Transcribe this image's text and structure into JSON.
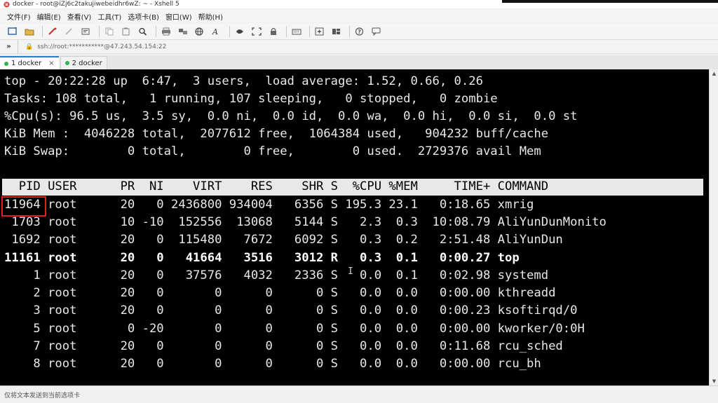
{
  "window": {
    "title": "docker - root@iZj6c2takujiwebeidhr6wZ: ~ - Xshell 5"
  },
  "menu": {
    "items": [
      "文件(F)",
      "编辑(E)",
      "查看(V)",
      "工具(T)",
      "选项卡(B)",
      "窗口(W)",
      "帮助(H)"
    ]
  },
  "toolbar": {
    "icons": [
      "new-session-icon",
      "open-folder-icon",
      "reconnect-icon",
      "disconnect-icon",
      "properties-icon",
      "copy-icon",
      "paste-icon",
      "find-icon",
      "print-icon",
      "transfer-icon",
      "globe-icon",
      "font-icon",
      "script-icon",
      "fullscreen-icon",
      "lock-icon",
      "keyboard-icon",
      "add-tab-icon",
      "layout-icon",
      "help-icon",
      "chat-icon"
    ]
  },
  "address": {
    "arrows": "»",
    "url": "ssh://root:***********@47.243.54.154:22"
  },
  "tabs": [
    {
      "label": "1 docker",
      "active": true
    },
    {
      "label": "2 docker",
      "active": false
    }
  ],
  "terminal": {
    "summary": [
      "top - 20:22:28 up  6:47,  3 users,  load average: 1.52, 0.66, 0.26",
      "Tasks: 108 total,   1 running, 107 sleeping,   0 stopped,   0 zombie",
      "%Cpu(s): 96.5 us,  3.5 sy,  0.0 ni,  0.0 id,  0.0 wa,  0.0 hi,  0.0 si,  0.0 st",
      "KiB Mem :  4046228 total,  2077612 free,  1064384 used,   904232 buff/cache",
      "KiB Swap:        0 total,        0 free,        0 used.  2729376 avail Mem"
    ],
    "header": "  PID USER      PR  NI    VIRT    RES    SHR S  %CPU %MEM     TIME+ COMMAND",
    "rows": [
      "11964 root      20   0 2436800 934004   6356 S 195.3 23.1   0:18.65 xmrig",
      " 1703 root      10 -10  152556  13068   5144 S   2.3  0.3  10:08.79 AliYunDunMonito",
      " 1692 root      20   0  115480   7672   6092 S   0.3  0.2   2:51.48 AliYunDun",
      "11161 root      20   0   41664   3516   3012 R   0.3  0.1   0:00.27 top",
      "    1 root      20   0   37576   4032   2336 S   0.0  0.1   0:02.98 systemd",
      "    2 root      20   0       0      0      0 S   0.0  0.0   0:00.00 kthreadd",
      "    3 root      20   0       0      0      0 S   0.0  0.0   0:00.23 ksoftirqd/0",
      "    5 root       0 -20       0      0      0 S   0.0  0.0   0:00.00 kworker/0:0H",
      "    7 root      20   0       0      0      0 S   0.0  0.0   0:11.68 rcu_sched",
      "    8 root      20   0       0      0      0 S   0.0  0.0   0:00.00 rcu_bh"
    ]
  },
  "status": {
    "text": "仅将文本发送到当前选项卡"
  },
  "colors": {
    "terminal_bg": "#000000",
    "terminal_fg": "#e8e8e8",
    "highlight": "#e02020",
    "tab_accent": "#2a7ad5"
  }
}
